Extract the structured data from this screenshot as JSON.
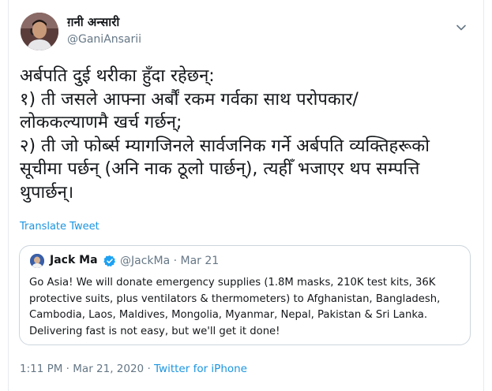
{
  "tweet": {
    "author_name": "ग़नी अन्सारी",
    "author_handle": "@GaniAnsarii",
    "text_lines": [
      "अर्बपति दुई थरीका हुँदा रहेछन्:",
      "१) ती जसले आफ्ना अर्बौं रकम गर्वका साथ परोपकार/",
      "लोककल्याणमै खर्च गर्छन्;",
      "२) ती जो फोर्ब्स म्यागजिनले सार्वजनिक गर्ने अर्बपति व्यक्तिहरूको",
      "सूचीमा पर्छन् (अनि नाक ठूलो पार्छन्), त्यहीँ भजाएर थप सम्पत्ति",
      "थुपार्छन्।"
    ],
    "translate_label": "Translate Tweet",
    "timestamp": "1:11 PM · Mar 21, 2020 · ",
    "source": "Twitter for iPhone"
  },
  "quote": {
    "author_name": "Jack Ma",
    "handle_date": "@JackMa · Mar 21",
    "text_lines": [
      "Go Asia! We will donate emergency supplies (1.8M masks, 210K test kits, 36K",
      "protective suits, plus ventilators & thermometers) to Afghanistan, Bangladesh,",
      "Cambodia, Laos, Maldives, Mongolia, Myanmar, Nepal, Pakistan & Sri Lanka.",
      "Delivering fast is not easy, but we'll get it done!"
    ]
  },
  "icons": {
    "caret": "chevron-down-icon",
    "verified": "verified-badge-icon"
  },
  "colors": {
    "link": "#1b95e0",
    "secondary_text": "#657786",
    "border": "#ccd6dd"
  }
}
